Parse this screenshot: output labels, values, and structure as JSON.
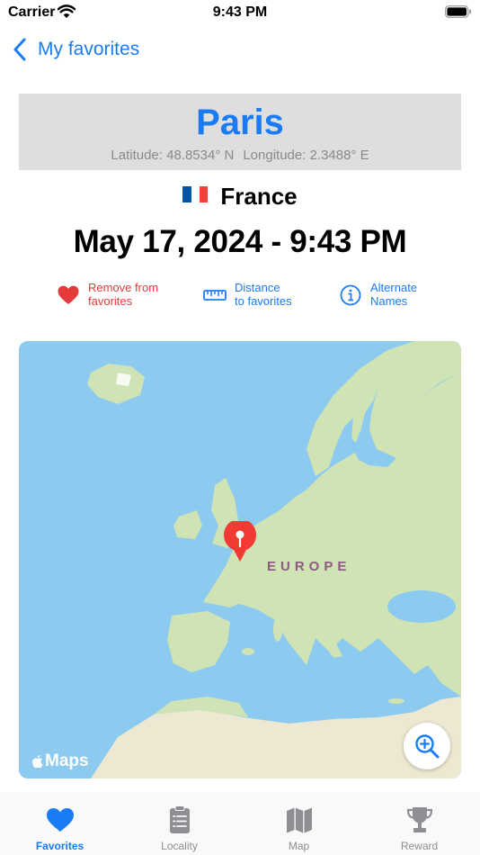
{
  "status_bar": {
    "carrier": "Carrier",
    "time": "9:43 PM"
  },
  "nav": {
    "back_label": "My favorites"
  },
  "city": {
    "name": "Paris",
    "latitude": "Latitude: 48.8534° N",
    "longitude": "Longitude: 2.3488° E"
  },
  "country": {
    "name": "France",
    "flag_colors": [
      "#0055a4",
      "#ffffff",
      "#ef4135"
    ]
  },
  "datetime": "May 17, 2024 - 9:43 PM",
  "actions": {
    "remove": {
      "line1": "Remove from",
      "line2": "favorites",
      "icon": "heart-icon",
      "color": "#e53a3a"
    },
    "distance": {
      "line1": "Distance",
      "line2": "to favorites",
      "icon": "ruler-icon",
      "color": "#1a7cf4"
    },
    "alternate": {
      "line1": "Alternate",
      "line2": "Names",
      "icon": "info-icon",
      "color": "#1a7cf4"
    }
  },
  "map": {
    "region_label": "EUROPE",
    "attribution": "Maps",
    "colors": {
      "water": "#8dcaf0",
      "land": "#cfe3b4",
      "desert": "#ece8d2",
      "pin": "#f03a33"
    }
  },
  "tabs": [
    {
      "label": "Favorites",
      "icon": "heart-icon",
      "active": true
    },
    {
      "label": "Locality",
      "icon": "clipboard-icon",
      "active": false
    },
    {
      "label": "Map",
      "icon": "map-icon",
      "active": false
    },
    {
      "label": "Reward",
      "icon": "trophy-icon",
      "active": false
    }
  ],
  "accent_color": "#1a7cf4"
}
